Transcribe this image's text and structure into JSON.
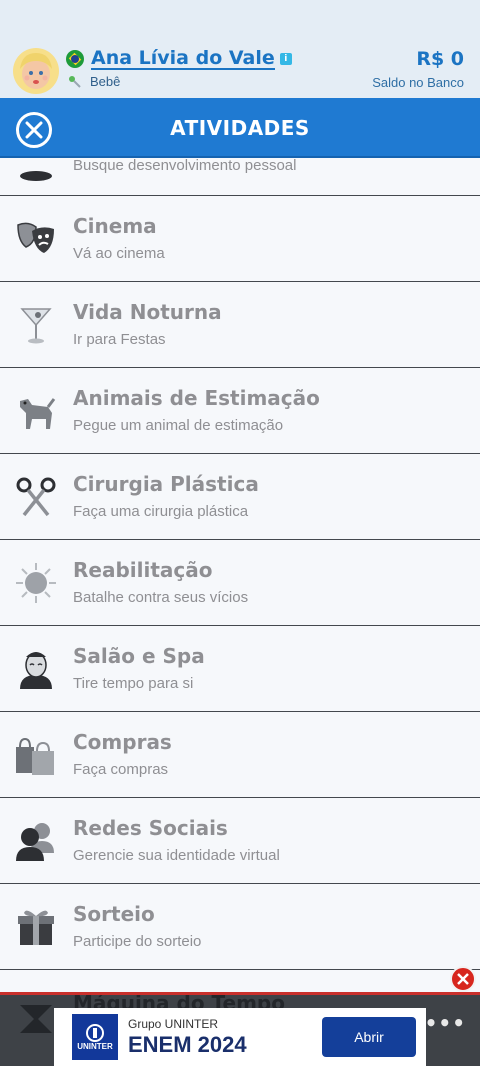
{
  "header": {
    "character_name": "Ana Lívia do Vale",
    "life_stage": "Bebê",
    "money": "R$ 0",
    "money_label": "Saldo no Banco",
    "flag_icon": "brazil-flag-icon",
    "avatar_icon": "baby-avatar-icon"
  },
  "titlebar": {
    "title": "ATIVIDADES",
    "close_icon": "close-icon"
  },
  "activities": [
    {
      "title": "",
      "subtitle": "Busque desenvolvimento pessoal",
      "icon": "mind-body-icon"
    },
    {
      "title": "Cinema",
      "subtitle": "Vá ao cinema",
      "icon": "theater-masks-icon"
    },
    {
      "title": "Vida Noturna",
      "subtitle": "Ir para Festas",
      "icon": "cocktail-glass-icon"
    },
    {
      "title": "Animais de Estimação",
      "subtitle": "Pegue um animal de estimação",
      "icon": "dog-icon"
    },
    {
      "title": "Cirurgia Plástica",
      "subtitle": "Faça uma cirurgia plástica",
      "icon": "scissors-icon"
    },
    {
      "title": "Reabilitação",
      "subtitle": "Batalhe contra seus vícios",
      "icon": "sun-icon"
    },
    {
      "title": "Salão e Spa",
      "subtitle": "Tire tempo para si",
      "icon": "spa-face-icon"
    },
    {
      "title": "Compras",
      "subtitle": "Faça compras",
      "icon": "shopping-bags-icon"
    },
    {
      "title": "Redes Sociais",
      "subtitle": "Gerencie sua identidade virtual",
      "icon": "people-icon"
    },
    {
      "title": "Sorteio",
      "subtitle": "Participe do sorteio",
      "icon": "gift-box-icon"
    },
    {
      "title": "Máquina do Tempo",
      "subtitle": "",
      "icon": "time-machine-icon"
    }
  ],
  "ad": {
    "brand": "Grupo UNINTER",
    "headline": "ENEM 2024",
    "cta": "Abrir",
    "logo_text": "UNINTER"
  },
  "colors": {
    "accent": "#1f7ad2",
    "name_blue": "#1b74c3",
    "item_text": "#8f8f93",
    "ad_button": "#143f9a"
  }
}
